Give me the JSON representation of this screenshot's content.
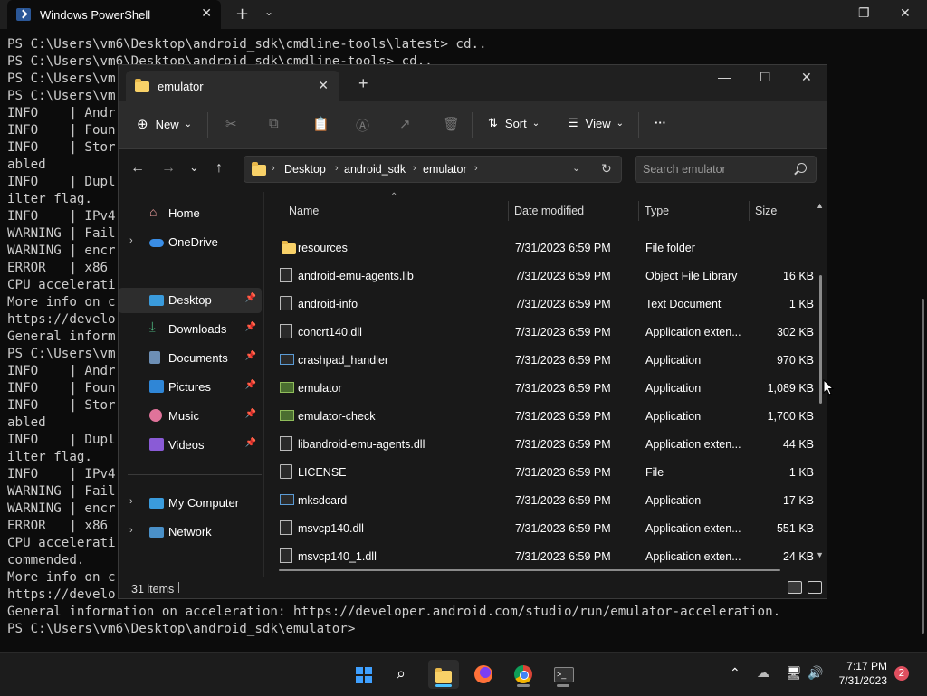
{
  "powershell": {
    "tab_title": "Windows PowerShell",
    "lines": [
      "PS C:\\Users\\vm6\\Desktop\\android_sdk\\cmdline-tools\\latest> cd..",
      "PS C:\\Users\\vm6\\Desktop\\android_sdk\\cmdline-tools> cd..",
      "PS C:\\Users\\vm",
      "PS C:\\Users\\vm",
      "INFO    | Andr",
      "INFO    | Foun",
      "INFO    | Stor                                                                            tion is en",
      "abled",
      "INFO    | Dupl                                                                            e -log-nof",
      "ilter flag.",
      "INFO    | IPv4",
      "WARNING | Fail                                                                            ding.",
      "WARNING | encr",
      "ERROR   | x86",
      "CPU accelerati",
      "More info on c",
      "https://develo",
      "General inform",
      "PS C:\\Users\\vm",
      "INFO    | Andr",
      "INFO    | Foun",
      "INFO    | Stor                                                                            tion is en",
      "abled",
      "INFO    | Dupl                                                                            e -log-nof",
      "ilter flag.",
      "INFO    | IPv4",
      "WARNING | Fail                                                                            ding.",
      "WARNING | encr",
      "ERROR   | x86",
      "CPU accelerati                                                                            6.5 is re",
      "commended.",
      "More info on c",
      "https://develo",
      "General information on acceleration: https://developer.android.com/studio/run/emulator-acceleration.",
      "PS C:\\Users\\vm6\\Desktop\\android_sdk\\emulator>"
    ]
  },
  "explorer": {
    "tab_title": "emulator",
    "toolbar": {
      "new_label": "New",
      "sort_label": "Sort",
      "view_label": "View",
      "more_label": "···"
    },
    "breadcrumb": [
      "Desktop",
      "android_sdk",
      "emulator"
    ],
    "search_placeholder": "Search emulator",
    "nav": {
      "home": "Home",
      "onedrive": "OneDrive",
      "desktop": "Desktop",
      "downloads": "Downloads",
      "documents": "Documents",
      "pictures": "Pictures",
      "music": "Music",
      "videos": "Videos",
      "mycomputer": "My Computer",
      "network": "Network"
    },
    "columns": {
      "name": "Name",
      "date": "Date modified",
      "type": "Type",
      "size": "Size"
    },
    "files": [
      {
        "name": "resources",
        "date": "7/31/2023 6:59 PM",
        "type": "File folder",
        "size": "",
        "icon": "folder-icon"
      },
      {
        "name": "android-emu-agents.lib",
        "date": "7/31/2023 6:59 PM",
        "type": "Object File Library",
        "size": "16 KB",
        "icon": "lib-file-icon"
      },
      {
        "name": "android-info",
        "date": "7/31/2023 6:59 PM",
        "type": "Text Document",
        "size": "1 KB",
        "icon": "text-file-icon"
      },
      {
        "name": "concrt140.dll",
        "date": "7/31/2023 6:59 PM",
        "type": "Application exten...",
        "size": "302 KB",
        "icon": "dll-file-icon"
      },
      {
        "name": "crashpad_handler",
        "date": "7/31/2023 6:59 PM",
        "type": "Application",
        "size": "970 KB",
        "icon": "exe-file-icon"
      },
      {
        "name": "emulator",
        "date": "7/31/2023 6:59 PM",
        "type": "Application",
        "size": "1,089 KB",
        "icon": "app-file-icon"
      },
      {
        "name": "emulator-check",
        "date": "7/31/2023 6:59 PM",
        "type": "Application",
        "size": "1,700 KB",
        "icon": "app-file-icon"
      },
      {
        "name": "libandroid-emu-agents.dll",
        "date": "7/31/2023 6:59 PM",
        "type": "Application exten...",
        "size": "44 KB",
        "icon": "dll-file-icon"
      },
      {
        "name": "LICENSE",
        "date": "7/31/2023 6:59 PM",
        "type": "File",
        "size": "1 KB",
        "icon": "blank-file-icon"
      },
      {
        "name": "mksdcard",
        "date": "7/31/2023 6:59 PM",
        "type": "Application",
        "size": "17 KB",
        "icon": "exe-file-icon"
      },
      {
        "name": "msvcp140.dll",
        "date": "7/31/2023 6:59 PM",
        "type": "Application exten...",
        "size": "551 KB",
        "icon": "dll-file-icon"
      },
      {
        "name": "msvcp140_1.dll",
        "date": "7/31/2023 6:59 PM",
        "type": "Application exten...",
        "size": "24 KB",
        "icon": "dll-file-icon"
      }
    ],
    "status": "31 items"
  },
  "taskbar": {
    "time": "7:17 PM",
    "date": "7/31/2023",
    "notification_count": "2"
  }
}
